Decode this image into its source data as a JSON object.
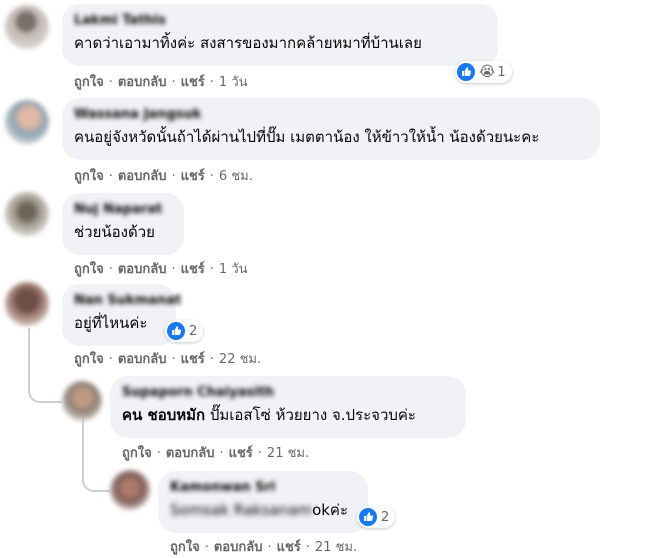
{
  "comments": [
    {
      "author": "Lakmi Tathis",
      "text": "คาดว่าเอามาทิ้งค่ะ สงสารของมากคล้ายหมาที่บ้านเลย",
      "reactions": {
        "emoji": "😭",
        "count": "1"
      },
      "actions": {
        "like": "ถูกใจ",
        "reply": "ตอบกลับ",
        "share": "แชร์",
        "time": "1 วัน"
      }
    },
    {
      "author": "Wassana Jangsuk",
      "text": "คนอยู่จังหวัดนั้นถ้าได้ผ่านไปที่ปั๊ม เมตตาน้อง ให้ข้าวให้น้ำ น้องด้วยนะคะ",
      "actions": {
        "like": "ถูกใจ",
        "reply": "ตอบกลับ",
        "share": "แชร์",
        "time": "6 ชม."
      }
    },
    {
      "author": "Nuj Naparat",
      "text": "ช่วยน้องด้วย",
      "actions": {
        "like": "ถูกใจ",
        "reply": "ตอบกลับ",
        "share": "แชร์",
        "time": "1 วัน"
      }
    },
    {
      "author": "Nan Sukmanat",
      "text": "อยู่ที่ไหนค่ะ",
      "reactions": {
        "count": "2"
      },
      "actions": {
        "like": "ถูกใจ",
        "reply": "ตอบกลับ",
        "share": "แชร์",
        "time": "22 ชม."
      }
    }
  ],
  "replies": [
    {
      "author": "Supaporn Chaiyasith",
      "mention": "คน ชอบหมัก",
      "text": " ปั๊มเอสโซ่ ห้วยยาง จ.ประจวบค่ะ",
      "actions": {
        "like": "ถูกใจ",
        "reply": "ตอบกลับ",
        "share": "แชร์",
        "time": "21 ชม."
      }
    },
    {
      "author": "Kamonwan Sri",
      "text_blurred": "Somsak Raksanam",
      "text": "okค่ะ",
      "reactions": {
        "count": "2"
      },
      "actions": {
        "like": "ถูกใจ",
        "reply": "ตอบกลับ",
        "share": "แชร์",
        "time": "21 ชม."
      }
    }
  ],
  "colors": {
    "bubble": "#f0f2f5",
    "meta_text": "#65676b",
    "like_blue": "#1877f2",
    "thread_line": "#ccd0d5"
  },
  "icons": {
    "like": "thumbs-up-icon",
    "cry": "crying-face-icon"
  }
}
